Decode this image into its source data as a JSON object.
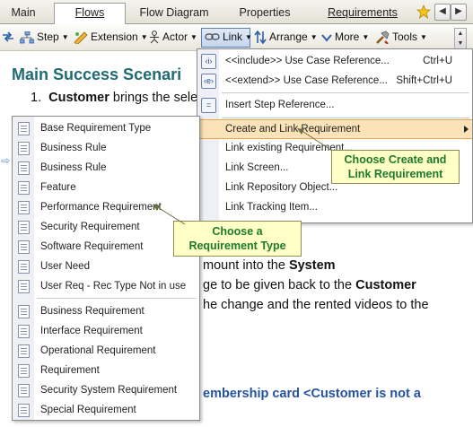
{
  "tabs": [
    {
      "label": "Main"
    },
    {
      "label": "Flows"
    },
    {
      "label": "Flow Diagram"
    },
    {
      "label": "Properties"
    },
    {
      "label": "Requirements"
    }
  ],
  "tab_nav": {
    "prev": "◀",
    "next": "▶"
  },
  "toolbar": {
    "step": "Step",
    "extension": "Extension",
    "actor": "Actor",
    "link": "Link",
    "arrange": "Arrange",
    "more": "More",
    "tools": "Tools"
  },
  "document": {
    "heading": "Main Success Scenari",
    "step1_num": "1.",
    "step1_actor": "Customer",
    "step1_rest": "brings the sele",
    "line_system_pre": "mount into the",
    "line_system_bold": "System",
    "line_customer_pre": "ge to be given back to the",
    "line_customer_bold": "Customer",
    "line_change": "he change and the rented videos to the",
    "line_blue": "embership card <Customer is not a"
  },
  "link_menu": {
    "items": [
      {
        "label": "<<include>> Use Case Reference...",
        "shortcut": "Ctrl+U",
        "icon": "include-icon",
        "glyph": "‹i›"
      },
      {
        "label": "<<extend>> Use Case Reference...",
        "shortcut": "Shift+Ctrl+U",
        "icon": "extend-icon",
        "glyph": "‹e›"
      },
      {
        "label": "Insert Step Reference...",
        "shortcut": "",
        "icon": "step-reference-icon",
        "glyph": "="
      },
      {
        "label": "Create and Link Requirement",
        "shortcut": "",
        "icon": "",
        "glyph": ""
      },
      {
        "label": "Link existing Requirement...",
        "shortcut": "",
        "icon": "",
        "glyph": ""
      },
      {
        "label": "Link Screen...",
        "shortcut": "",
        "icon": "",
        "glyph": ""
      },
      {
        "label": "Link Repository Object...",
        "shortcut": "",
        "icon": "",
        "glyph": ""
      },
      {
        "label": "Link Tracking Item...",
        "shortcut": "",
        "icon": "",
        "glyph": ""
      }
    ]
  },
  "requirement_menu": {
    "items": [
      "Base Requirement Type",
      "Business Rule",
      "Business Rule",
      "Feature",
      "Performance Requirement",
      "Security Requirement",
      "Software Requirement",
      "User Need",
      "User Req - Rec Type Not in use",
      "Business Requirement",
      "Interface Requirement",
      "Operational Requirement",
      "Requirement",
      "Security System Requirement",
      "Special Requirement"
    ]
  },
  "callouts": {
    "create_link_line1": "Choose Create and",
    "create_link_line2": "Link Requirement",
    "req_type_line1": "Choose a",
    "req_type_line2": "Requirement Type"
  },
  "colors": {
    "heading": "#1f6b73",
    "callout_text": "#1b7a2b",
    "callout_bg": "#ffffc6",
    "menu_highlight": "#fbe3b7",
    "blue_text": "#2453a4"
  }
}
